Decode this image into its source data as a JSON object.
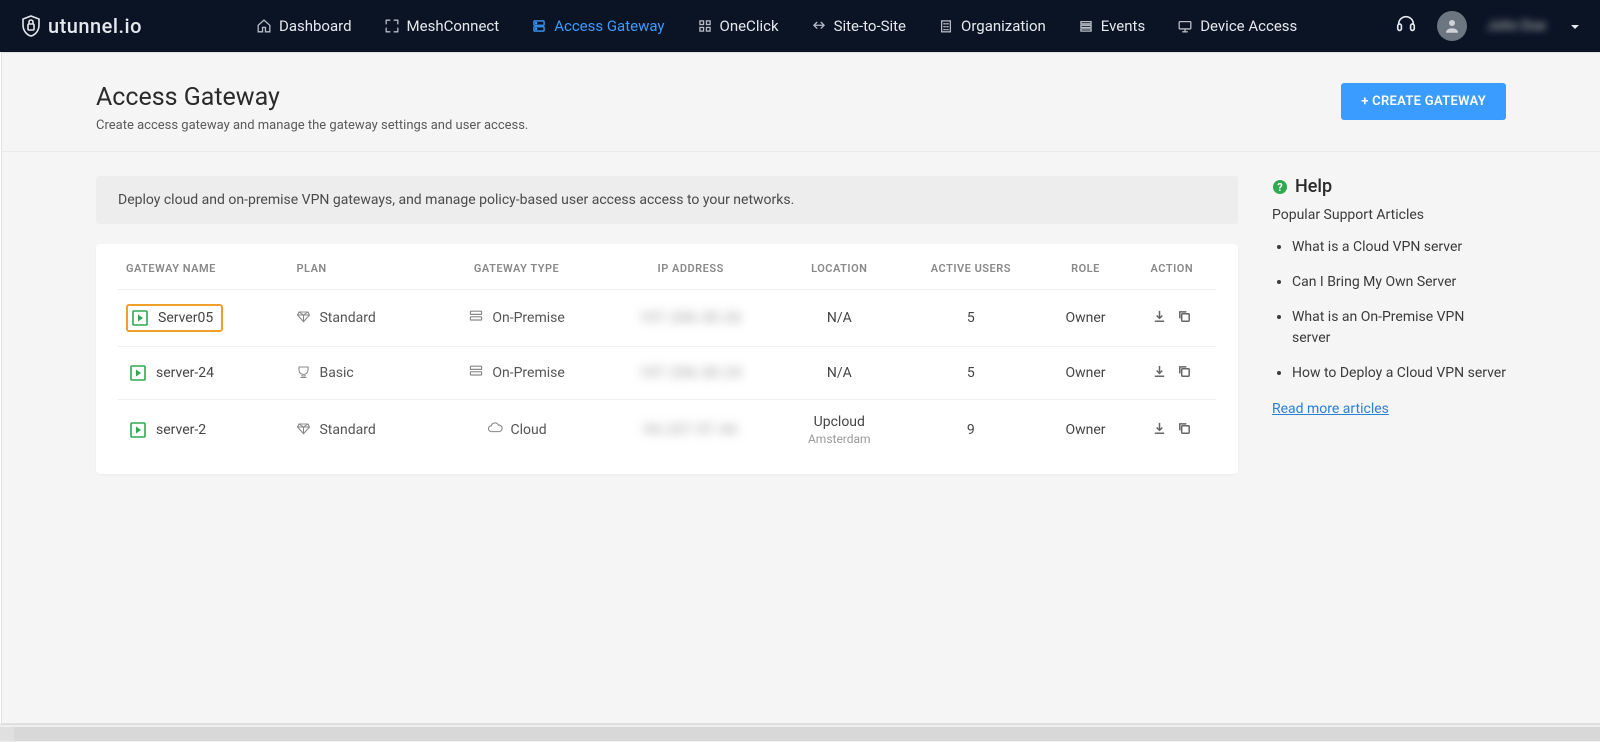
{
  "brand": "utunnel.io",
  "nav": {
    "items": [
      {
        "label": "Dashboard",
        "icon": "home"
      },
      {
        "label": "MeshConnect",
        "icon": "fullscreen"
      },
      {
        "label": "Access Gateway",
        "icon": "server",
        "active": true
      },
      {
        "label": "OneClick",
        "icon": "grid"
      },
      {
        "label": "Site-to-Site",
        "icon": "link"
      },
      {
        "label": "Organization",
        "icon": "building"
      },
      {
        "label": "Events",
        "icon": "list"
      },
      {
        "label": "Device Access",
        "icon": "monitor"
      }
    ],
    "username": "John Doe"
  },
  "page": {
    "title": "Access Gateway",
    "subtitle": "Create access gateway and manage the gateway settings and user access.",
    "create_button": "+ CREATE GATEWAY"
  },
  "banner": "Deploy cloud and on-premise VPN gateways, and manage policy-based user access access to your networks.",
  "table": {
    "headers": {
      "name": "GATEWAY NAME",
      "plan": "PLAN",
      "type": "GATEWAY TYPE",
      "ip": "IP ADDRESS",
      "location": "LOCATION",
      "users": "ACTIVE USERS",
      "role": "ROLE",
      "action": "ACTION"
    },
    "rows": [
      {
        "name": "Server05",
        "highlight": true,
        "plan": "Standard",
        "plan_icon": "diamond",
        "type": "On-Premise",
        "type_icon": "onprem",
        "ip": "107.206.30.26",
        "location": "N/A",
        "sublocation": "",
        "users": "5",
        "role": "Owner"
      },
      {
        "name": "server-24",
        "highlight": false,
        "plan": "Basic",
        "plan_icon": "trophy",
        "type": "On-Premise",
        "type_icon": "onprem",
        "ip": "107.206.30.24",
        "location": "N/A",
        "sublocation": "",
        "users": "5",
        "role": "Owner"
      },
      {
        "name": "server-2",
        "highlight": false,
        "plan": "Standard",
        "plan_icon": "diamond",
        "type": "Cloud",
        "type_icon": "cloud",
        "ip": "94.237.97.44",
        "location": "Upcloud",
        "sublocation": "Amsterdam",
        "users": "9",
        "role": "Owner"
      }
    ]
  },
  "help": {
    "title": "Help",
    "subtitle": "Popular Support Articles",
    "articles": [
      "What is a Cloud VPN server",
      "Can I Bring My Own Server",
      "What is an On-Premise VPN server",
      "How to Deploy a Cloud VPN server"
    ],
    "read_more": "Read more articles"
  }
}
